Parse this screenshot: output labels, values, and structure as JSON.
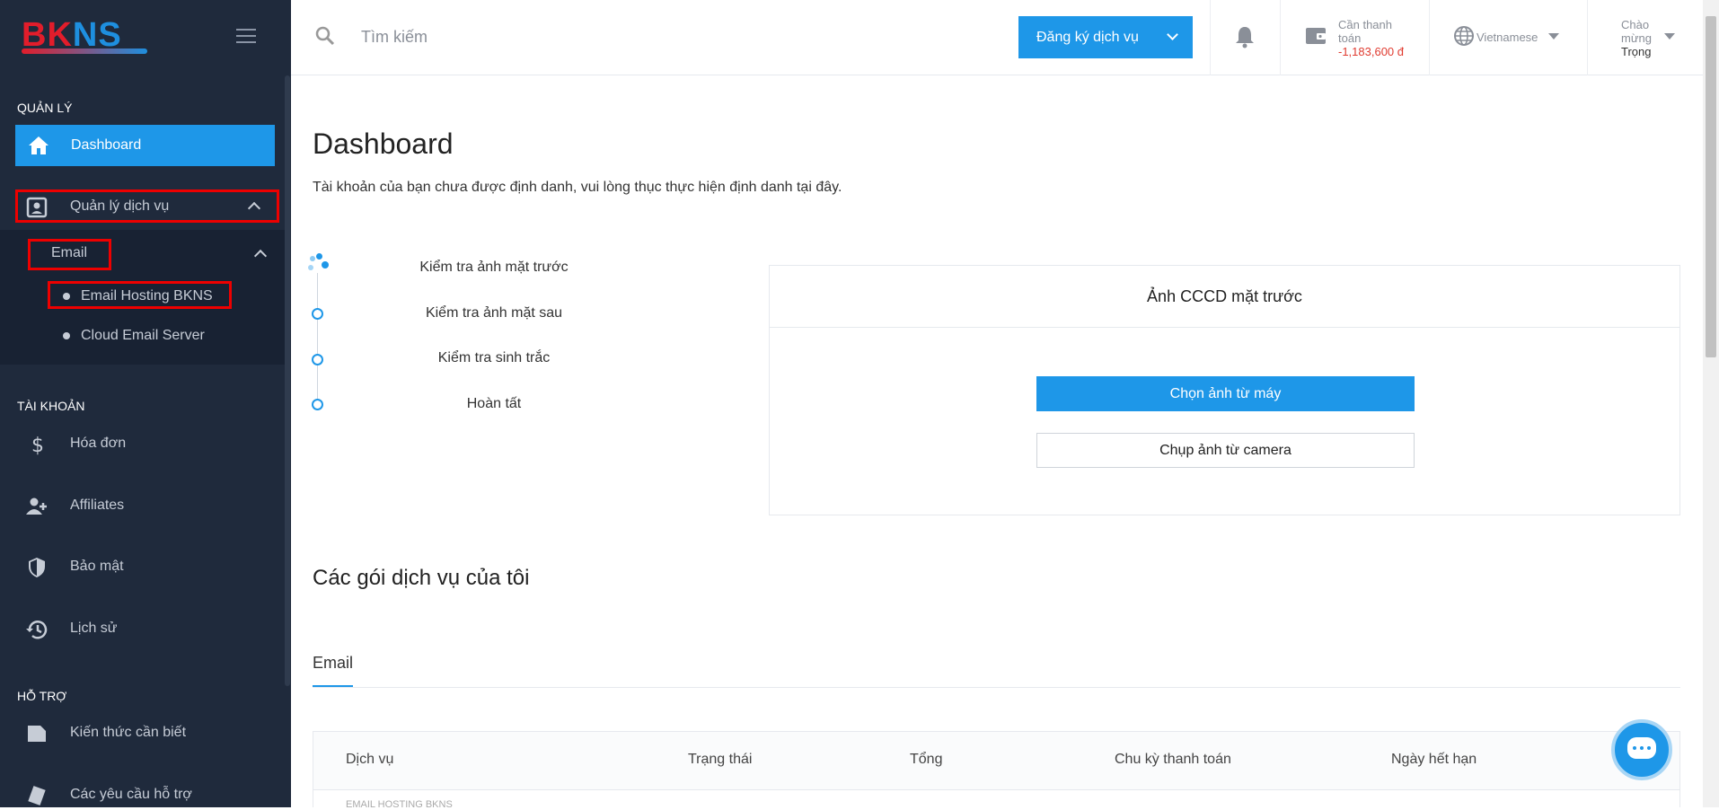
{
  "brand": {
    "logo_text_red": "BK",
    "logo_text_blue": "NS"
  },
  "sidebar": {
    "section_manage": "QUẢN LÝ",
    "dashboard_label": "Dashboard",
    "service_mgmt_label": "Quản lý dịch vụ",
    "email_label": "Email",
    "email_sub_items": [
      "Email Hosting BKNS",
      "Cloud Email Server"
    ],
    "section_account": "TÀI KHOẢN",
    "account_items": [
      "Hóa đơn",
      "Affiliates",
      "Bảo mật",
      "Lịch sử"
    ],
    "section_support": "HỖ TRỢ",
    "support_items": [
      "Kiến thức cần biết",
      "Các yêu cầu hỗ trợ"
    ]
  },
  "topbar": {
    "search_placeholder": "Tìm kiếm",
    "register_button": "Đăng ký dịch vụ",
    "payment_label": "Cần thanh toán",
    "payment_amount": "-1,183,600 đ",
    "language": "Vietnamese",
    "greeting": "Chào mừng",
    "user_name": "Trọng"
  },
  "main": {
    "title": "Dashboard",
    "notice": "Tài khoản của bạn chưa được định danh, vui lòng thục thực hiện định danh tại đây.",
    "steps": [
      "Kiểm tra ảnh mặt trước",
      "Kiểm tra ảnh mặt sau",
      "Kiểm tra sinh trắc",
      "Hoàn tất"
    ],
    "card_title": "Ảnh CCCD mặt trước",
    "choose_photo_button": "Chọn ảnh từ máy",
    "camera_button": "Chụp ảnh từ camera",
    "services_title": "Các gói dịch vụ của tôi",
    "tab_email": "Email",
    "table_headers": [
      "Dịch vụ",
      "Trạng thái",
      "Tổng",
      "Chu kỳ thanh toán",
      "Ngày hết hạn"
    ],
    "first_row_text": "EMAIL HOSTING BKNS"
  },
  "colors": {
    "accent": "#1e97e8",
    "sidebar_bg": "#1f2a3c",
    "highlight_border": "#e00000",
    "negative": "#e03c31"
  }
}
